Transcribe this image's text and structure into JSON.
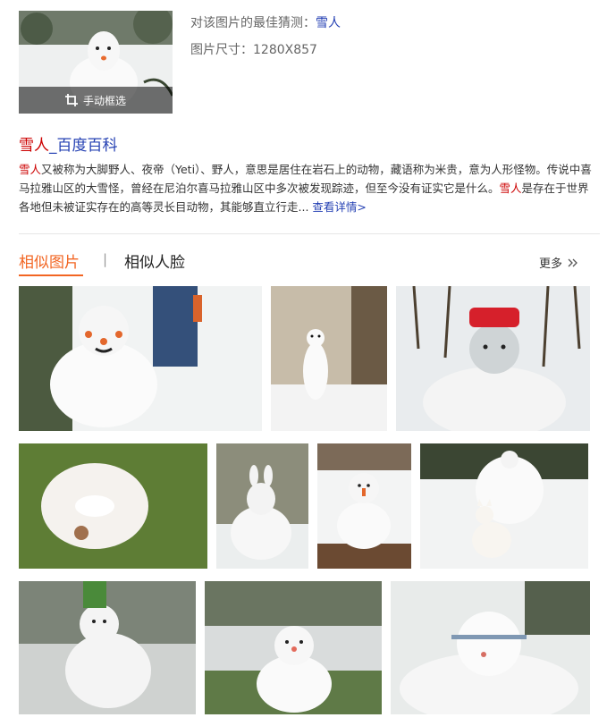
{
  "query": {
    "crop_label": "手动框选",
    "guess_prefix": "对该图片的最佳猜测：",
    "guess_value": "雪人",
    "size_text": "图片尺寸：1280X857"
  },
  "baike": {
    "title_hl": "雪人",
    "title_rest": "_百度百科",
    "desc_hl1": "雪人",
    "desc_part1": "又被称为大脚野人、夜帝（Yeti）、野人，意思是居住在岩石上的动物，藏语称为米贵，意为人形怪物。传说中喜马拉雅山区的大雪怪，曾经在尼泊尔喜马拉雅山区中多次被发现踪迹，但至今没有证实它是什么。",
    "desc_hl2": "雪人",
    "desc_part2": "是存在于世界各地但未被证实存在的高等灵长目动物，其能够直立行走...",
    "more_link": "查看详情>"
  },
  "tabs": {
    "similar_images": "相似图片",
    "separator": "|",
    "similar_faces": "相似人脸",
    "more": "更多"
  },
  "icons": {
    "crop": "crop-icon",
    "more_chevron": "double-chevron-right-icon"
  },
  "colors": {
    "link_blue": "#2440b3",
    "highlight_red": "#cc0000",
    "tab_orange": "#f26522"
  }
}
